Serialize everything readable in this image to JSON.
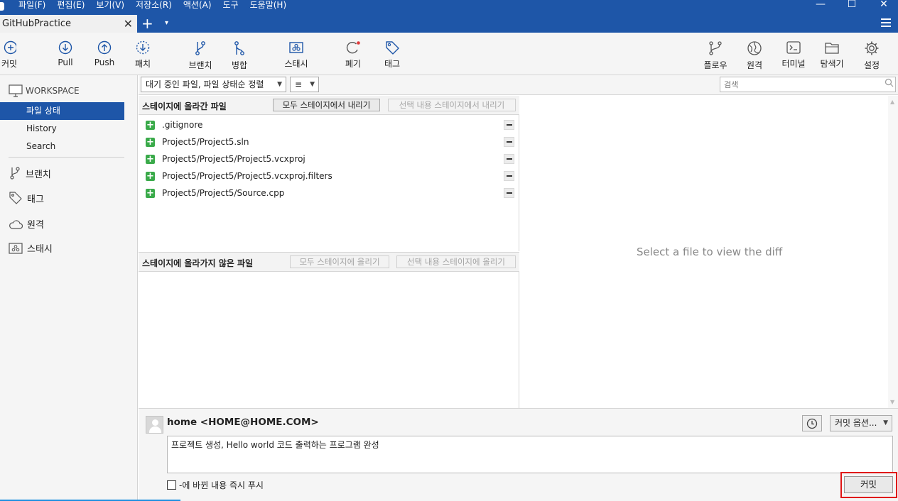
{
  "menu": [
    "파일(F)",
    "편집(E)",
    "보기(V)",
    "저장소(R)",
    "액션(A)",
    "도구",
    "도움말(H)"
  ],
  "window_controls": {
    "minimize": "—",
    "maximize": "☐",
    "close": "✕"
  },
  "tab": {
    "label": "GitHubPractice",
    "close": "✕",
    "new_tab": "+",
    "dropdown": "▾"
  },
  "toolbar": {
    "commit": "커밋",
    "pull": "Pull",
    "push": "Push",
    "patch": "패치",
    "branch": "브랜치",
    "merge": "병합",
    "stash": "스태시",
    "discard": "폐기",
    "tag": "태그",
    "flow": "플로우",
    "remote": "원격",
    "terminal": "터미널",
    "explorer": "탐색기",
    "settings": "설정"
  },
  "sidebar": {
    "workspace": "WORKSPACE",
    "items": [
      "파일 상태",
      "History",
      "Search"
    ],
    "sections": [
      "브랜치",
      "태그",
      "원격",
      "스태시"
    ]
  },
  "filter": {
    "sort_label": "대기 중인 파일, 파일 상태순 정렬",
    "view_mode": "≡",
    "search_placeholder": "검색"
  },
  "staged": {
    "title": "스테이지에 올라간 파일",
    "unstage_all": "모두 스테이지에서 내리기",
    "unstage_selected": "선택 내용 스테이지에서 내리기",
    "files": [
      ".gitignore",
      "Project5/Project5.sln",
      "Project5/Project5/Project5.vcxproj",
      "Project5/Project5/Project5.vcxproj.filters",
      "Project5/Project5/Source.cpp"
    ]
  },
  "unstaged": {
    "title": "스테이지에 올라가지 않은 파일",
    "stage_all": "모두 스테이지에 올리기",
    "stage_selected": "선택 내용 스테이지에 올리기"
  },
  "diff": {
    "empty_message": "Select a file to view the diff"
  },
  "commit": {
    "author": "home <HOME@HOME.COM>",
    "options": "커밋 옵션...",
    "message": "프로젝트 생성, Hello world 코드 출력하는 프로그램 완성",
    "push_label": "-에 바뀐 내용 즉시 푸시",
    "push_checked": false,
    "button": "커밋"
  },
  "colors": {
    "accent": "#1e56a8",
    "highlight_outline": "#e01515",
    "added": "#3aaa4a"
  }
}
